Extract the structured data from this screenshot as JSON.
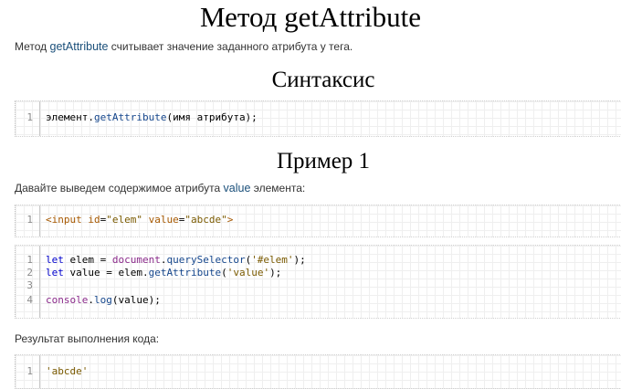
{
  "page": {
    "title": "Метод getAttribute",
    "intro": {
      "before": "Метод ",
      "code": "getAttribute",
      "after": " считывает значение заданного атрибута у тега."
    },
    "syntax": {
      "heading": "Синтаксис",
      "line_number": "1",
      "code_prefix": "элемент.",
      "code_method": "getAttribute",
      "code_suffix": "(имя атрибута);"
    },
    "example1": {
      "heading": "Пример 1",
      "description": {
        "before": "Давайте выведем содержимое атрибута ",
        "code": "value",
        "after": " элемента:"
      },
      "html_block": {
        "line_number": "1",
        "open_tag": "<input",
        "attr1_name": "id",
        "attr1_value": "\"elem\"",
        "attr2_name": "value",
        "attr2_value": "\"abcde\"",
        "close_tag": ">"
      },
      "js_block": {
        "lines": [
          {
            "n": "1",
            "kw": "let",
            "var": " elem = ",
            "obj": "document",
            "dot": ".",
            "method": "querySelector",
            "args_open": "(",
            "arg": "'#elem'",
            "args_close": ");"
          },
          {
            "n": "2",
            "kw": "let",
            "var": " value = elem.",
            "method": "getAttribute",
            "args_open": "(",
            "arg": "'value'",
            "args_close": ");"
          },
          {
            "n": "3"
          },
          {
            "n": "4",
            "obj": "console",
            "dot": ".",
            "method": "log",
            "rest": "(value);"
          }
        ]
      },
      "result_label": "Результат выполнения кода:",
      "result_block": {
        "line_number": "1",
        "value": "'abcde'"
      }
    }
  },
  "colors": {
    "heading": "#000000",
    "text": "#333333",
    "keyword": "#0000cc",
    "method": "#15468c",
    "string": "#7a5a00",
    "html_tag": "#a65800",
    "grid": "#efefef"
  }
}
